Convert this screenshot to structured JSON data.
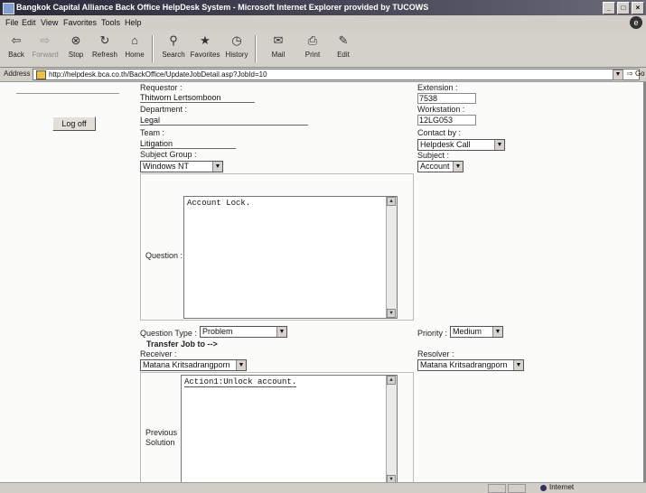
{
  "window": {
    "title": "Bangkok Capital Alliance Back Office HelpDesk System - Microsoft Internet Explorer provided by TUCOWS",
    "controls": [
      "_",
      "□",
      "×"
    ]
  },
  "menu": [
    "File",
    "Edit",
    "View",
    "Favorites",
    "Tools",
    "Help"
  ],
  "toolbar": [
    {
      "label": "Back",
      "icon": "back-arrow-icon"
    },
    {
      "label": "Forward",
      "icon": "forward-arrow-icon"
    },
    {
      "label": "Stop",
      "icon": "stop-icon"
    },
    {
      "label": "Refresh",
      "icon": "refresh-icon"
    },
    {
      "label": "Home",
      "icon": "home-icon"
    },
    {
      "label": "Search",
      "icon": "search-icon"
    },
    {
      "label": "Favorites",
      "icon": "favorites-icon"
    },
    {
      "label": "History",
      "icon": "history-icon"
    },
    {
      "label": "Mail",
      "icon": "mail-icon"
    },
    {
      "label": "Print",
      "icon": "print-icon"
    },
    {
      "label": "Edit",
      "icon": "edit-icon"
    }
  ],
  "address": {
    "label": "Address",
    "url": "http://helpdesk.bca.co.th/BackOffice/UpdateJobDetail.asp?JobId=10",
    "go": "Go"
  },
  "sidebar": {
    "logoff_label": "Log off"
  },
  "form": {
    "requestor_label": "Requestor :",
    "requestor_value": "Thitworn Lertsomboon",
    "department_label": "Department :",
    "department_value": "Legal",
    "team_label": "Team :",
    "team_value": "Litigation",
    "subject_group_label": "Subject Group :",
    "subject_group_value": "Windows NT",
    "question_label": "Question :",
    "question_value": "Account Lock.",
    "extension_label": "Extension :",
    "extension_value": "7538",
    "workstation_label": "Workstation :",
    "workstation_value": "12LG053",
    "contact_by_label": "Contact by :",
    "contact_by_value": "Helpdesk Call",
    "subject_label": "Subject :",
    "subject_value": "Account",
    "question_type_label": "Question Type :",
    "question_type_value": "Problem",
    "priority_label": "Priority :",
    "priority_value": "Medium",
    "transfer_label": "Transfer Job to -->",
    "receiver_label": "Receiver :",
    "receiver_value": "Matana Kritsadrangporn",
    "resolver_label": "Resolver :",
    "resolver_value": "Matana Kritsadrangporn",
    "previous_solution_label": "Previous Solution",
    "previous_solution_value": "Action1:Unlock account."
  },
  "status": {
    "zone": "Internet"
  }
}
